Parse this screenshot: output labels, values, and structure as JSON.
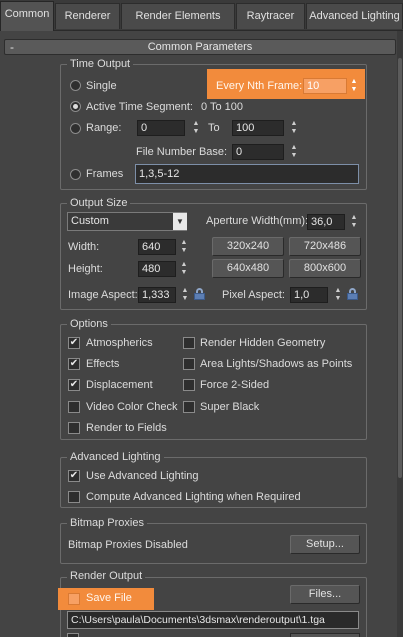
{
  "tabs": [
    {
      "label": "Common",
      "active": true
    },
    {
      "label": "Renderer"
    },
    {
      "label": "Render Elements"
    },
    {
      "label": "Raytracer"
    },
    {
      "label": "Advanced Lighting"
    }
  ],
  "rollout": {
    "toggle": "-",
    "title": "Common Parameters"
  },
  "time_output": {
    "title": "Time Output",
    "single": "Single",
    "every_nth_label": "Every Nth Frame:",
    "every_nth_value": "10",
    "active_segment": "Active Time Segment:",
    "active_segment_value": "0 To 100",
    "range": "Range:",
    "range_from": "0",
    "range_to_label": "To",
    "range_to": "100",
    "file_number_base_label": "File Number Base:",
    "file_number_base": "0",
    "frames": "Frames",
    "frames_value": "1,3,5-12",
    "selected": "active_segment"
  },
  "output_size": {
    "title": "Output Size",
    "preset": "Custom",
    "aperture_label": "Aperture Width(mm):",
    "aperture_value": "36,0",
    "width_label": "Width:",
    "width": "640",
    "height_label": "Height:",
    "height": "480",
    "presets": [
      "320x240",
      "720x486",
      "640x480",
      "800x600"
    ],
    "image_aspect_label": "Image Aspect:",
    "image_aspect": "1,333",
    "pixel_aspect_label": "Pixel Aspect:",
    "pixel_aspect": "1,0"
  },
  "options": {
    "title": "Options",
    "left": [
      {
        "label": "Atmospherics",
        "checked": true
      },
      {
        "label": "Effects",
        "checked": true
      },
      {
        "label": "Displacement",
        "checked": true
      },
      {
        "label": "Video Color Check",
        "checked": false
      },
      {
        "label": "Render to Fields",
        "checked": false
      }
    ],
    "right": [
      {
        "label": "Render Hidden Geometry",
        "checked": false
      },
      {
        "label": "Area Lights/Shadows as Points",
        "checked": false
      },
      {
        "label": "Force 2-Sided",
        "checked": false
      },
      {
        "label": "Super Black",
        "checked": false
      }
    ]
  },
  "advanced_lighting": {
    "title": "Advanced Lighting",
    "use": "Use Advanced Lighting",
    "use_checked": true,
    "compute": "Compute Advanced Lighting when Required",
    "compute_checked": false
  },
  "bitmap_proxies": {
    "title": "Bitmap Proxies",
    "status": "Bitmap Proxies Disabled",
    "setup": "Setup..."
  },
  "render_output": {
    "title": "Render Output",
    "save_file": "Save File",
    "files": "Files...",
    "path": "C:\\Users\\paula\\Documents\\3dsmax\\renderoutput\\1.tga"
  },
  "colors": {
    "highlight": "#f28b3c",
    "background": "#444444"
  }
}
